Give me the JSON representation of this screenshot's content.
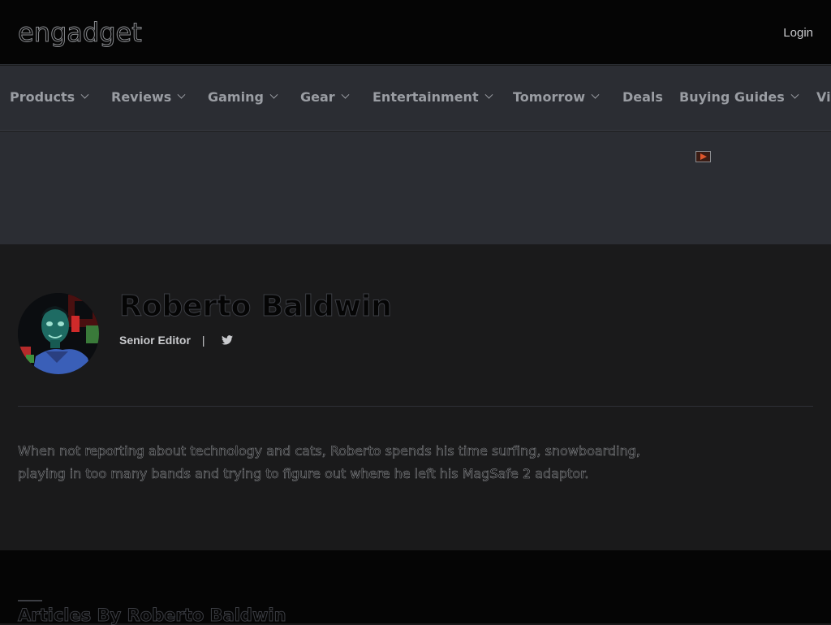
{
  "header": {
    "logo_text": "engadget",
    "login_label": "Login"
  },
  "nav": {
    "items": [
      {
        "label": "Products",
        "has_dropdown": true
      },
      {
        "label": "Reviews",
        "has_dropdown": true
      },
      {
        "label": "Gaming",
        "has_dropdown": true
      },
      {
        "label": "Gear",
        "has_dropdown": true
      },
      {
        "label": "Entertainment",
        "has_dropdown": true
      },
      {
        "label": "Tomorrow",
        "has_dropdown": true
      },
      {
        "label": "Deals",
        "has_dropdown": false
      },
      {
        "label": "Buying Guides",
        "has_dropdown": true
      },
      {
        "label": "Vi",
        "has_dropdown": false
      }
    ]
  },
  "ad": {
    "icon": "ad-choices-icon"
  },
  "author": {
    "name": "Roberto Baldwin",
    "title": "Senior Editor",
    "separator": "|",
    "social_icon": "twitter-icon",
    "bio": "When not reporting about technology and cats, Roberto spends his time surfing, snowboarding, playing in too many bands and trying to figure out where he left his MagSafe 2 adaptor."
  },
  "articles": {
    "heading": "Articles By Roberto Baldwin"
  },
  "colors": {
    "topbar_bg": "#050505",
    "nav_bg": "#2b2d33",
    "profile_bg": "#1a1a1b",
    "nav_text": "#9a9da3"
  }
}
